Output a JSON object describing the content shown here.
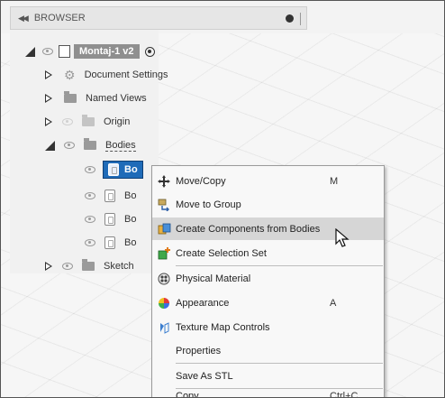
{
  "browser": {
    "collapse_icon": "double-chevron-left-icon",
    "title": "BROWSER"
  },
  "tree": {
    "root": {
      "label": "Montaj-1 v2"
    },
    "document_settings": "Document Settings",
    "named_views": "Named Views",
    "origin": "Origin",
    "bodies": "Bodies",
    "body_selected": "Bo",
    "body_2": "Bo",
    "body_3": "Bo",
    "body_4": "Bo",
    "sketches": "Sketch"
  },
  "context_menu": {
    "items": [
      {
        "label": "Move/Copy",
        "shortcut": "M",
        "icon": "move-icon"
      },
      {
        "label": "Move to Group",
        "shortcut": "",
        "icon": "group-icon"
      },
      {
        "label": "Create Components from Bodies",
        "shortcut": "",
        "icon": "component-icon"
      },
      {
        "label": "Create Selection Set",
        "shortcut": "",
        "icon": "selection-set-icon"
      },
      {
        "label": "Physical Material",
        "shortcut": "",
        "icon": "material-icon"
      },
      {
        "label": "Appearance",
        "shortcut": "A",
        "icon": "appearance-icon"
      },
      {
        "label": "Texture Map Controls",
        "shortcut": "",
        "icon": "texture-icon"
      },
      {
        "label": "Properties",
        "shortcut": ""
      },
      {
        "label": "Save As STL",
        "shortcut": ""
      },
      {
        "label": "Copy",
        "shortcut": "Ctrl+C"
      }
    ]
  },
  "colors": {
    "selection": "#1f6bb8",
    "hover": "#d6d6d6",
    "root_label_bg": "#8f8f8f"
  }
}
